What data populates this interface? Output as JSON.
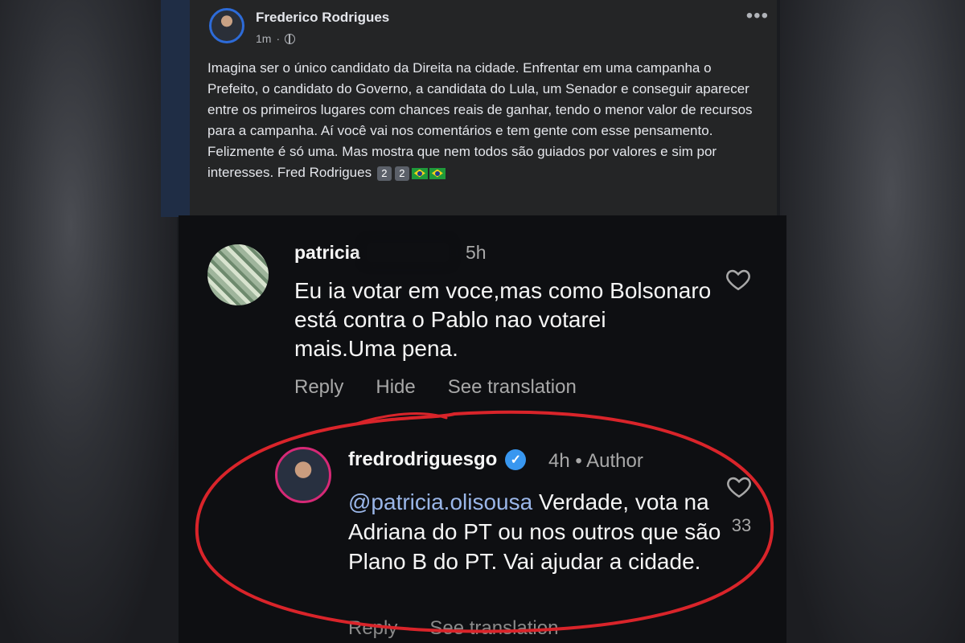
{
  "facebook_post": {
    "author": "Frederico Rodrigues",
    "time": "1m",
    "more_icon": "more-horizontal-icon",
    "text_line1": "Imagina ser o único candidato da Direita na cidade. Enfrentar em uma campanha o Prefeito, o candidato do Governo, a candidata do Lula, um Senador e conseguir aparecer entre os primeiros lugares com chances reais de ganhar, tendo o menor valor de recursos para a campanha. Aí você vai nos comentários e tem gente com esse pensamento.",
    "text_line2": "Felizmente é só uma. Mas mostra que nem todos são guiados por valores e sim por interesses. Fred Rodrigues",
    "key1": "2",
    "key2": "2"
  },
  "comment1": {
    "username": "patricia",
    "time": "5h",
    "text": "Eu ia votar em voce,mas como Bolsonaro está contra o Pablo nao votarei mais.Uma pena.",
    "actions": {
      "reply": "Reply",
      "hide": "Hide",
      "translate": "See translation"
    }
  },
  "comment2": {
    "username": "fredrodriguesgo",
    "verified_icon": "verified-badge-icon",
    "time": "4h • Author",
    "mention": "@patricia.olisousa",
    "text": " Verdade, vota na Adriana do PT ou nos outros que são Plano B do PT. Vai ajudar a cidade.",
    "likes": "33",
    "actions": {
      "reply": "Reply",
      "translate": "See translation"
    }
  },
  "colors": {
    "fb_bg": "#242526",
    "ig_bg": "#0e0f12",
    "annotation_circle": "#d9242a",
    "verified": "#3897f0"
  }
}
